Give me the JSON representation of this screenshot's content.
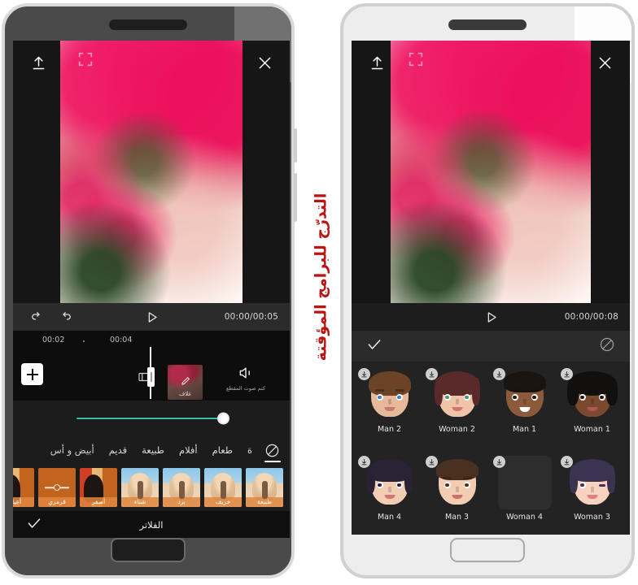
{
  "watermark": {
    "text": "التدرّج للبرامج المؤقتة",
    "color": "#bb1313"
  },
  "left_phone": {
    "name": "dark-phone",
    "topbar": {
      "export_icon": "export-up-arrow-icon",
      "close_icon": "close-x-icon",
      "expand_icon": "expand-fullscreen-icon"
    },
    "transport": {
      "redo_icon": "redo-arrow-icon",
      "undo_icon": "undo-arrow-icon",
      "play_icon": "play-triangle-icon",
      "time": "00:00/00:05"
    },
    "timeline": {
      "ruler_marks": [
        "00:02",
        "00:04"
      ],
      "add_button_icon": "plus-add-clip-icon",
      "split_icon": "split-clip-icon",
      "cover_clip": {
        "label": "غلاف",
        "edit_icon": "pencil-edit-icon"
      },
      "mute": {
        "label": "كتم صوت المقطع",
        "icon": "speaker-volume-icon"
      }
    },
    "slider": {
      "value_percent": 100,
      "accent_color": "#3dbfa5"
    },
    "filter_tabs": [
      {
        "label": "",
        "icon": "no-filter-circle-slash-icon",
        "active": true
      },
      {
        "label": "ة",
        "icon": "",
        "active": false
      },
      {
        "label": "طعام",
        "icon": "",
        "active": false
      },
      {
        "label": "أفلام",
        "icon": "",
        "active": false
      },
      {
        "label": "طبيعة",
        "icon": "",
        "active": false
      },
      {
        "label": "قديم",
        "icon": "",
        "active": false
      },
      {
        "label": "أبيض و أس",
        "icon": "",
        "active": false
      }
    ],
    "filter_thumbs": [
      {
        "label": "طبيعة",
        "style": "sky"
      },
      {
        "label": "خريف",
        "style": "sky"
      },
      {
        "label": "برد",
        "style": "sky"
      },
      {
        "label": "شتاء",
        "style": "sky"
      },
      {
        "label": "أصفر",
        "style": "portrait"
      },
      {
        "label": "قرمزي",
        "style": "swatch"
      },
      {
        "label": "أعياد",
        "style": "portrait"
      }
    ],
    "actionbar": {
      "title": "الفلاتر",
      "confirm_icon": "check-mark-icon"
    }
  },
  "right_phone": {
    "name": "light-phone",
    "topbar": {
      "export_icon": "export-up-arrow-icon",
      "close_icon": "close-x-icon",
      "expand_icon": "expand-fullscreen-icon"
    },
    "transport": {
      "play_icon": "play-triangle-icon",
      "time": "00:00/00:08"
    },
    "confirmbar": {
      "confirm_icon": "check-mark-icon",
      "cancel_icon": "circle-slash-ban-icon"
    },
    "avatars": [
      {
        "name": "Man 2",
        "download_icon": "download-arrow-icon",
        "skin": "#e8b89a",
        "hair": "#6b4428",
        "eye": "#3f7fbf",
        "loading": false
      },
      {
        "name": "Woman 2",
        "download_icon": "download-arrow-icon",
        "skin": "#f0c4a8",
        "hair": "#5a2a2a",
        "eye": "#4d9a74",
        "loading": false
      },
      {
        "name": "Man 1",
        "download_icon": "download-arrow-icon",
        "skin": "#8a5a3a",
        "hair": "#1a1410",
        "eye": "#2a1a12",
        "loading": false
      },
      {
        "name": "Woman 1",
        "download_icon": "download-arrow-icon",
        "skin": "#7a4a30",
        "hair": "#12100e",
        "eye": "#2a1a12",
        "loading": false
      },
      {
        "name": "Man 4",
        "download_icon": "download-arrow-icon",
        "skin": "#f2cdb4",
        "hair": "#2a2336",
        "eye": "#2c2440",
        "loading": false
      },
      {
        "name": "Man 3",
        "download_icon": "download-arrow-icon",
        "skin": "#f3cdb2",
        "hair": "#4a3020",
        "eye": "#4a3224",
        "loading": false
      },
      {
        "name": "Woman 4",
        "download_icon": "download-arrow-icon",
        "skin": "#2d2d2d",
        "hair": "#2d2d2d",
        "eye": "#2d2d2d",
        "loading": true
      },
      {
        "name": "Woman 3",
        "download_icon": "download-arrow-icon",
        "skin": "#f7d2be",
        "hair": "#3b3350",
        "eye": "#3a3356",
        "loading": false
      }
    ]
  }
}
